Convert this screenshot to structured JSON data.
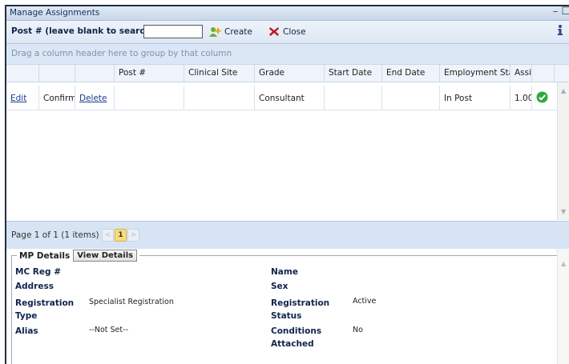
{
  "window": {
    "title": "Manage Assignments",
    "controls": "– ☐"
  },
  "toolbar": {
    "post_label": "Post # (leave blank to search):",
    "post_value": "",
    "create_label": "Create",
    "close_label": "Close"
  },
  "group_hint": "Drag a column header here to group by that column",
  "grid": {
    "columns": [
      "",
      "",
      "",
      "Post #",
      "Clinical Site",
      "Grade",
      "Start Date",
      "End Date",
      "Employment Stat",
      "Assig",
      ""
    ],
    "row": {
      "edit": "Edit",
      "confirm": "Confirm",
      "delete": "Delete",
      "post": "",
      "site": "",
      "grade": "Consultant",
      "start": "",
      "end": "",
      "status": "In Post",
      "assig": "1.00"
    }
  },
  "pager": {
    "text": "Page 1 of 1 (1 items)",
    "current_page": "1",
    "prev": "<",
    "next": ">"
  },
  "details": {
    "legend": "MP Details",
    "view_button": "View Details",
    "fields": {
      "mc_reg_label": "MC Reg #",
      "mc_reg_value": "",
      "address_label": "Address",
      "reg_type_label": "Registration Type",
      "reg_type_value": "Specialist Registration",
      "alias_label": "Alias",
      "alias_value": "--Not Set--",
      "name_label": "Name",
      "sex_label": "Sex",
      "reg_status_label": "Registration Status",
      "reg_status_value": "Active",
      "conditions_label": "Conditions Attached",
      "conditions_value": "No"
    }
  },
  "colors": {
    "accent": "#d6e4f4",
    "check": "#2eaa3d",
    "close_x": "#c0121c"
  },
  "icons": [
    "create-user-icon",
    "close-x-icon",
    "info-icon",
    "check-circle-icon"
  ]
}
